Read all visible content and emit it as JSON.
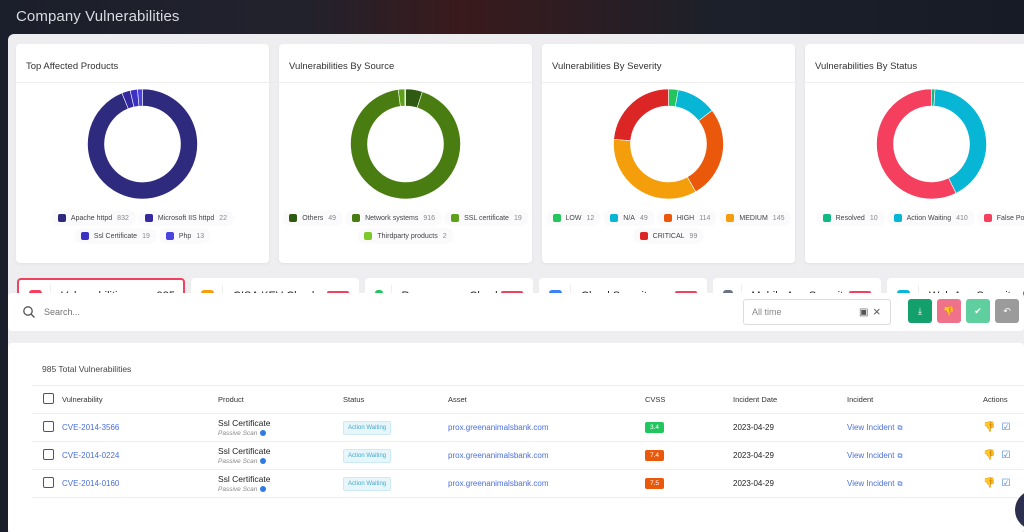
{
  "header": {
    "title": "Company Vulnerabilities"
  },
  "charts": [
    {
      "title": "Top Affected Products",
      "legend": [
        {
          "label": "Apache httpd",
          "count": "832",
          "color": "#2e2a7e"
        },
        {
          "label": "Microsoft IIS httpd",
          "count": "22",
          "color": "#3429a0"
        },
        {
          "label": "Ssl Certificate",
          "count": "19",
          "color": "#3b32c4"
        },
        {
          "label": "Php",
          "count": "13",
          "color": "#4b43e0"
        }
      ]
    },
    {
      "title": "Vulnerabilities By Source",
      "legend": [
        {
          "label": "Others",
          "count": "49",
          "color": "#2f5a12"
        },
        {
          "label": "Network systems",
          "count": "916",
          "color": "#4a7d11"
        },
        {
          "label": "SSL certificate",
          "count": "19",
          "color": "#5fa01a"
        },
        {
          "label": "Thirdparty products",
          "count": "2",
          "color": "#7cc829"
        }
      ]
    },
    {
      "title": "Vulnerabilities By Severity",
      "legend": [
        {
          "label": "LOW",
          "count": "12",
          "color": "#22c55e"
        },
        {
          "label": "N/A",
          "count": "49",
          "color": "#06b6d4"
        },
        {
          "label": "HIGH",
          "count": "114",
          "color": "#ea580c"
        },
        {
          "label": "MEDIUM",
          "count": "145",
          "color": "#f59e0b"
        },
        {
          "label": "CRITICAL",
          "count": "99",
          "color": "#dc2626"
        }
      ]
    },
    {
      "title": "Vulnerabilities By Status",
      "legend": [
        {
          "label": "Resolved",
          "count": "10",
          "color": "#10b981"
        },
        {
          "label": "Action Waiting",
          "count": "410",
          "color": "#06b6d4"
        },
        {
          "label": "False Positive",
          "count": "",
          "color": "#f43f5e"
        }
      ]
    }
  ],
  "chart_data": [
    {
      "type": "pie",
      "title": "Top Affected Products",
      "categories": [
        "Apache httpd",
        "Microsoft IIS httpd",
        "Ssl Certificate",
        "Php"
      ],
      "values": [
        832,
        22,
        19,
        13
      ],
      "legend": "bottom"
    },
    {
      "type": "pie",
      "title": "Vulnerabilities By Source",
      "categories": [
        "Others",
        "Network systems",
        "SSL certificate",
        "Thirdparty products"
      ],
      "values": [
        49,
        916,
        19,
        2
      ],
      "legend": "bottom"
    },
    {
      "type": "pie",
      "title": "Vulnerabilities By Severity",
      "categories": [
        "LOW",
        "N/A",
        "HIGH",
        "MEDIUM",
        "CRITICAL"
      ],
      "values": [
        12,
        49,
        114,
        145,
        99
      ],
      "legend": "bottom"
    },
    {
      "type": "pie",
      "title": "Vulnerabilities By Status",
      "categories": [
        "Resolved",
        "Action Waiting",
        "False Positive"
      ],
      "values": [
        10,
        410,
        565
      ],
      "legend": "bottom"
    }
  ],
  "tiles": [
    {
      "label": "Vulnerabilities",
      "count": "985",
      "color": "#f43f5e",
      "badge": ""
    },
    {
      "label": "CISA KEV Check",
      "count": "",
      "color": "#f59e0b",
      "badge": "Beta"
    },
    {
      "label": "Ransomware Check",
      "count": "",
      "color": "#22c55e",
      "badge": "Beta"
    },
    {
      "label": "Cloud Security",
      "count": "",
      "color": "#3b82f6",
      "badge": "Beta"
    },
    {
      "label": "Mobile App Security",
      "count": "",
      "color": "#6b7280",
      "badge": "Beta"
    },
    {
      "label": "Web App Security",
      "count": "",
      "color": "#06b6d4",
      "badge": "Beta"
    }
  ],
  "search": {
    "placeholder": "Search..."
  },
  "date_filter": {
    "value": "All time"
  },
  "action_buttons": [
    {
      "name": "download",
      "glyph": "⤓",
      "color": "#14a06c"
    },
    {
      "name": "false-positive",
      "glyph": "👎",
      "color": "#f0728a"
    },
    {
      "name": "resolve",
      "glyph": "✔",
      "color": "#5fcf9f"
    },
    {
      "name": "revert",
      "glyph": "↶",
      "color": "#9b9b9b"
    }
  ],
  "table": {
    "total_label": "985 Total Vulnerabilities",
    "columns": [
      "Vulnerability",
      "Product",
      "Status",
      "Asset",
      "CVSS",
      "Incident Date",
      "Incident",
      "Actions"
    ],
    "rows": [
      {
        "cve": "CVE-2014-3566",
        "product": "Ssl Certificate",
        "scan": "Passive Scan",
        "status": "Action Waiting",
        "asset": "prox.greenanimalsbank.com",
        "cvss": "3.4",
        "cvss_color": "#22c55e",
        "date": "2023-04-29",
        "incident": "View Incident"
      },
      {
        "cve": "CVE-2014-0224",
        "product": "Ssl Certificate",
        "scan": "Passive Scan",
        "status": "Action Waiting",
        "asset": "prox.greenanimalsbank.com",
        "cvss": "7.4",
        "cvss_color": "#ea580c",
        "date": "2023-04-29",
        "incident": "View Incident"
      },
      {
        "cve": "CVE-2014-0160",
        "product": "Ssl Certificate",
        "scan": "Passive Scan",
        "status": "Action Waiting",
        "asset": "prox.greenanimalsbank.com",
        "cvss": "7.5",
        "cvss_color": "#ea580c",
        "date": "2023-04-29",
        "incident": "View Incident"
      }
    ]
  }
}
